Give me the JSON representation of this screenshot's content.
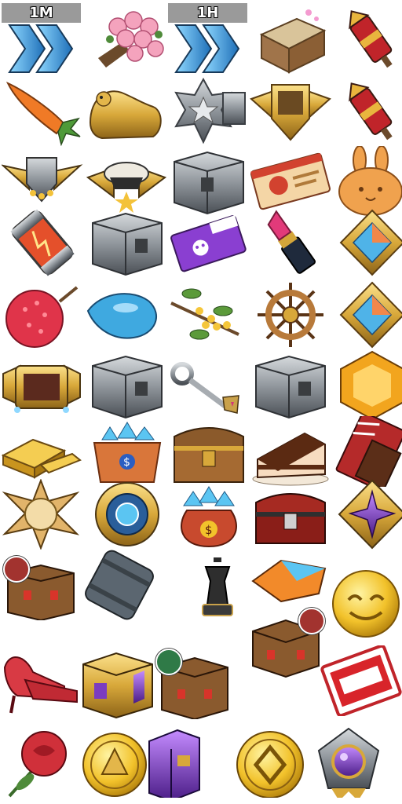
{
  "labels": {
    "speedup_1m": "1M",
    "speedup_1h": "1H"
  },
  "colors": {
    "gold": "#d8a83a",
    "steel": "#8f959b",
    "crate_red": "#b63a2c",
    "purple": "#7b3cc0",
    "blue_gem": "#4fb3e8",
    "coin": "#f2c22b",
    "badge_red": "#a2332f",
    "badge_green": "#2f7a47"
  },
  "items": [
    "speedup-1m-icon",
    "rose-bouquet-icon",
    "speedup-1h-icon",
    "treasure-map-chest-icon",
    "firework-rocket-icon",
    "carrot-icon",
    "golden-tiger-icon",
    "silver-star-badge-icon",
    "gold-winged-shield-icon",
    "firework-rocket-icon",
    "winged-shield-stars-icon",
    "officer-cap-badge-icon",
    "steel-crate-icon",
    "ship-ticket-icon",
    "bunny-cookie-icon",
    "energy-capsule-icon",
    "steel-crate-icon",
    "purple-skull-ticket-icon",
    "lipstick-icon",
    "prism-gem-icon",
    "lychee-icon",
    "water-drop-icon",
    "osmanthus-branch-icon",
    "ship-wheel-icon",
    "prism-gem-icon",
    "gold-frame-icon",
    "steel-crate-icon",
    "ornate-key-icon",
    "steel-crate-icon",
    "amber-gem-icon",
    "gold-bars-icon",
    "blue-gem-box-icon",
    "wooden-chest-icon",
    "chocolate-cake-icon",
    "chocolate-bar-icon",
    "sun-emblem-icon",
    "blue-gear-core-icon",
    "blue-gem-sack-icon",
    "red-chest-icon",
    "purple-star-gem-icon",
    "lucky-crate-icon",
    "steel-barrel-icon",
    "chess-king-icon",
    "fire-crystal-icon",
    "smile-coin-icon",
    "red-heels-icon",
    "purple-gold-crate-icon",
    "lucky-crate-icon",
    "lucky-crate-icon",
    "bingo-ticket-icon",
    "red-rose-icon",
    "gold-crest-coin-icon",
    "purple-crate-icon",
    "gold-diamond-coin-icon",
    "purple-orb-emblem-icon"
  ]
}
